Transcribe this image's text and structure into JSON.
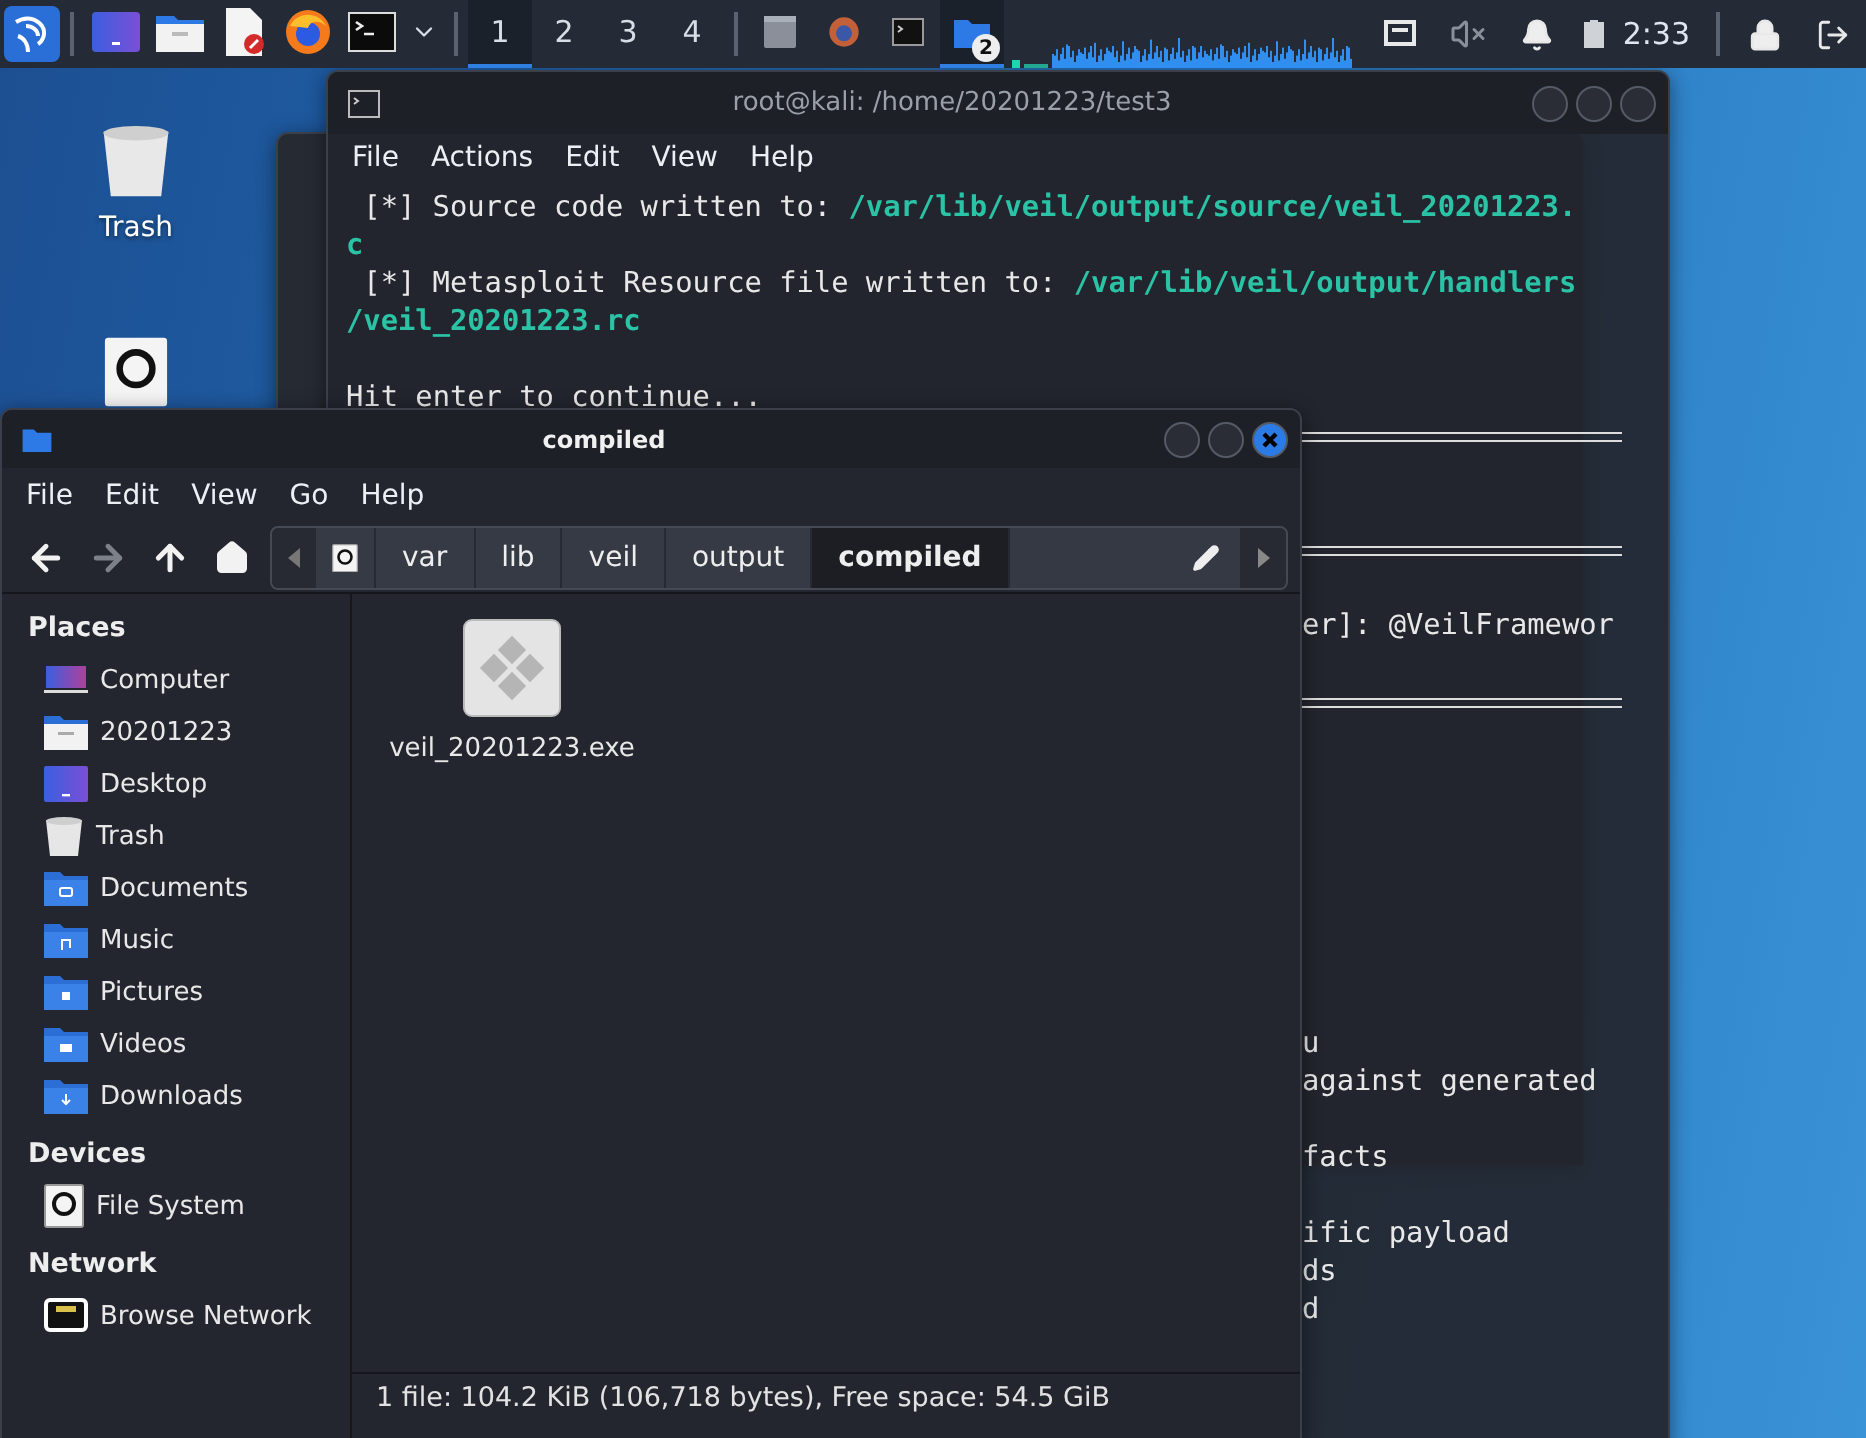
{
  "taskbar": {
    "launchers": [
      {
        "kind": "desktop"
      },
      {
        "kind": "files"
      },
      {
        "kind": "editor"
      },
      {
        "kind": "browser"
      },
      {
        "kind": "terminal"
      }
    ],
    "workspaces": [
      {
        "label": "1",
        "selected": true
      },
      {
        "label": "2",
        "selected": false
      },
      {
        "label": "3",
        "selected": false
      },
      {
        "label": "4",
        "selected": false
      }
    ],
    "windows": [
      {
        "kind": "window",
        "selected": false
      },
      {
        "kind": "browser",
        "selected": false
      },
      {
        "kind": "terminal",
        "selected": false
      },
      {
        "kind": "files",
        "selected": true,
        "badge": "2"
      }
    ],
    "clock": "2:33"
  },
  "desktop": {
    "icons": [
      {
        "kind": "trash",
        "label": "Trash"
      },
      {
        "kind": "drive"
      }
    ]
  },
  "terminal": {
    "title": "root@kali: /home/20201223/test3",
    "menu": [
      "File",
      "Actions",
      "Edit",
      "View",
      "Help"
    ],
    "lines": [
      {
        "kind": "message",
        "text": "[*] Source code written to:",
        "path": "/var/lib/veil/output/source/veil_20201223."
      },
      {
        "kind": "path",
        "path": "c"
      },
      {
        "kind": "message",
        "text": "[*] Metasploit Resource file written to:",
        "path": "/var/lib/veil/output/handlers"
      },
      {
        "kind": "path",
        "path": "/veil_20201223.rc"
      },
      {
        "kind": "blank"
      },
      {
        "kind": "plain",
        "text": "Hit enter to continue..."
      },
      {
        "kind": "rule"
      },
      {
        "kind": "blank"
      },
      {
        "kind": "blank"
      },
      {
        "kind": "rule"
      },
      {
        "kind": "blank"
      },
      {
        "kind": "fragment",
        "text": "er]: @VeilFramewor"
      },
      {
        "kind": "blank"
      },
      {
        "kind": "rule"
      },
      {
        "kind": "blank"
      },
      {
        "kind": "blank"
      },
      {
        "kind": "blank"
      },
      {
        "kind": "blank"
      },
      {
        "kind": "blank"
      },
      {
        "kind": "blank"
      },
      {
        "kind": "blank"
      },
      {
        "kind": "blank"
      },
      {
        "kind": "fragment",
        "text": "u"
      },
      {
        "kind": "fragment",
        "text": "against generated"
      },
      {
        "kind": "blank"
      },
      {
        "kind": "fragment",
        "text": "facts"
      },
      {
        "kind": "blank"
      },
      {
        "kind": "fragment",
        "text": "ific payload"
      },
      {
        "kind": "fragment",
        "text": "ds"
      },
      {
        "kind": "fragment",
        "text": "d"
      }
    ]
  },
  "file_manager": {
    "title": "compiled",
    "menu": [
      "File",
      "Edit",
      "View",
      "Go",
      "Help"
    ],
    "toolbar": [
      {
        "kind": "back",
        "disabled": false
      },
      {
        "kind": "forward",
        "disabled": true
      },
      {
        "kind": "up",
        "disabled": false
      },
      {
        "kind": "home",
        "disabled": false
      }
    ],
    "path": [
      {
        "kind": "drive",
        "selected": false
      },
      {
        "kind": "folder",
        "label": "var",
        "selected": false
      },
      {
        "kind": "folder",
        "label": "lib",
        "selected": false
      },
      {
        "kind": "folder",
        "label": "veil",
        "selected": false
      },
      {
        "kind": "folder",
        "label": "output",
        "selected": false
      },
      {
        "kind": "folder",
        "label": "compiled",
        "selected": true
      }
    ],
    "sidebar": [
      {
        "title": "Places",
        "items": [
          {
            "kind": "computer",
            "label": "Computer"
          },
          {
            "kind": "home",
            "label": "20201223"
          },
          {
            "kind": "desktop",
            "label": "Desktop"
          },
          {
            "kind": "trash",
            "label": "Trash"
          },
          {
            "kind": "documents",
            "label": "Documents"
          },
          {
            "kind": "music",
            "label": "Music"
          },
          {
            "kind": "pictures",
            "label": "Pictures"
          },
          {
            "kind": "videos",
            "label": "Videos"
          },
          {
            "kind": "downloads",
            "label": "Downloads"
          }
        ]
      },
      {
        "title": "Devices",
        "items": [
          {
            "kind": "drive",
            "label": "File System"
          }
        ]
      },
      {
        "title": "Network",
        "items": [
          {
            "kind": "network",
            "label": "Browse Network"
          }
        ]
      }
    ],
    "files": [
      {
        "kind": "executable",
        "name": "veil_20201223.exe"
      }
    ],
    "status": "1 file: 104.2 KiB (106,718 bytes), Free space: 54.5 GiB"
  }
}
